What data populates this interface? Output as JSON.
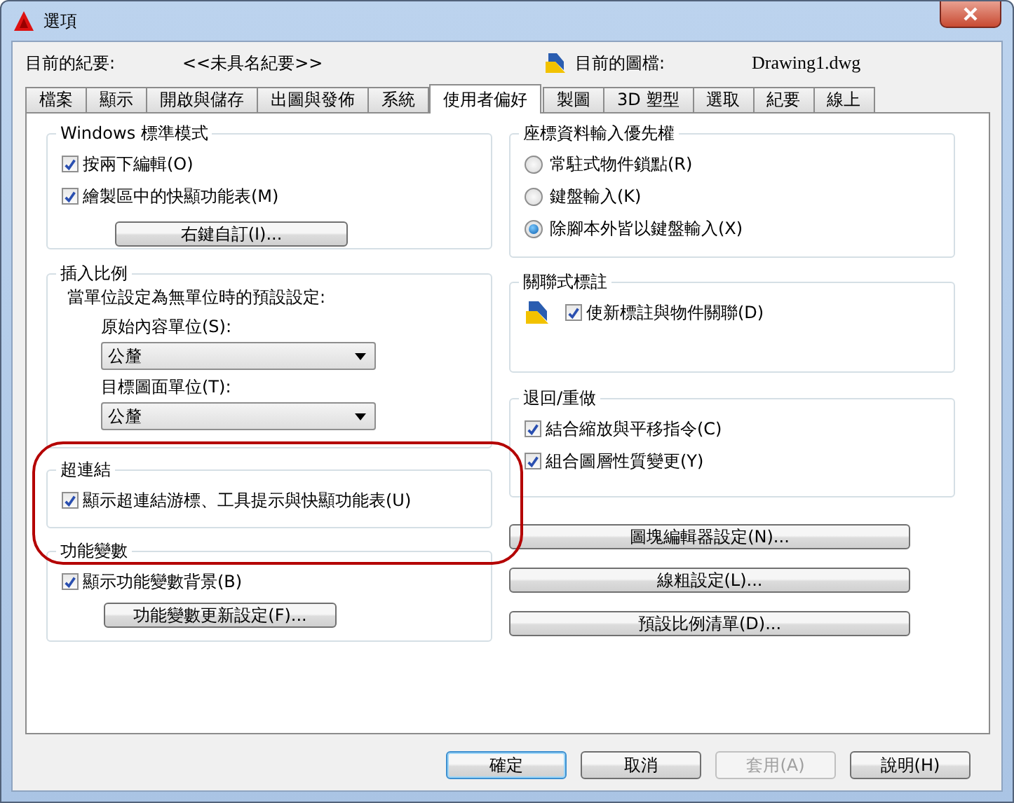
{
  "window": {
    "title": "選項"
  },
  "info": {
    "profile_label": "目前的紀要:",
    "profile_value": "<<未具名紀要>>",
    "drawing_label": "目前的圖檔:",
    "drawing_value": "Drawing1.dwg"
  },
  "tabs": [
    {
      "label": "檔案",
      "selected": false
    },
    {
      "label": "顯示",
      "selected": false
    },
    {
      "label": "開啟與儲存",
      "selected": false
    },
    {
      "label": "出圖與發佈",
      "selected": false
    },
    {
      "label": "系統",
      "selected": false
    },
    {
      "label": "使用者偏好",
      "selected": true
    },
    {
      "label": "製圖",
      "selected": false
    },
    {
      "label": "3D 塑型",
      "selected": false
    },
    {
      "label": "選取",
      "selected": false
    },
    {
      "label": "紀要",
      "selected": false
    },
    {
      "label": "線上",
      "selected": false
    }
  ],
  "windows_standard": {
    "title": "Windows 標準模式",
    "checkboxes": [
      {
        "label": "按兩下編輯(O)",
        "checked": true
      },
      {
        "label": "繪製區中的快顯功能表(M)",
        "checked": true
      }
    ],
    "button": "右鍵自訂(I)..."
  },
  "insertion_scale": {
    "title": "插入比例",
    "description": "當單位設定為無單位時的預設設定:",
    "fields": [
      {
        "label": "原始內容單位(S):",
        "value": "公釐"
      },
      {
        "label": "目標圖面單位(T):",
        "value": "公釐"
      }
    ]
  },
  "hyperlink": {
    "title": "超連結",
    "checkboxes": [
      {
        "label": "顯示超連結游標、工具提示與快顯功能表(U)",
        "checked": true
      }
    ]
  },
  "fields": {
    "title": "功能變數",
    "checkboxes": [
      {
        "label": "顯示功能變數背景(B)",
        "checked": true
      }
    ],
    "button": "功能變數更新設定(F)..."
  },
  "coordinate_priority": {
    "title": "座標資料輸入優先權",
    "radios": [
      {
        "label": "常駐式物件鎖點(R)",
        "selected": false
      },
      {
        "label": "鍵盤輸入(K)",
        "selected": false
      },
      {
        "label": "除腳本外皆以鍵盤輸入(X)",
        "selected": true
      }
    ]
  },
  "associative_dimensioning": {
    "title": "關聯式標註",
    "checkboxes": [
      {
        "label": "使新標註與物件關聯(D)",
        "checked": true
      }
    ]
  },
  "undo_redo": {
    "title": "退回/重做",
    "checkboxes": [
      {
        "label": "結合縮放與平移指令(C)",
        "checked": true
      },
      {
        "label": "組合圖層性質變更(Y)",
        "checked": true
      }
    ]
  },
  "side_buttons": [
    "圖塊編輯器設定(N)...",
    "線粗設定(L)...",
    "預設比例清單(D)..."
  ],
  "footer_buttons": [
    {
      "label": "確定",
      "default": true,
      "disabled": false
    },
    {
      "label": "取消",
      "default": false,
      "disabled": false
    },
    {
      "label": "套用(A)",
      "default": false,
      "disabled": true
    },
    {
      "label": "說明(H)",
      "default": false,
      "disabled": false
    }
  ]
}
